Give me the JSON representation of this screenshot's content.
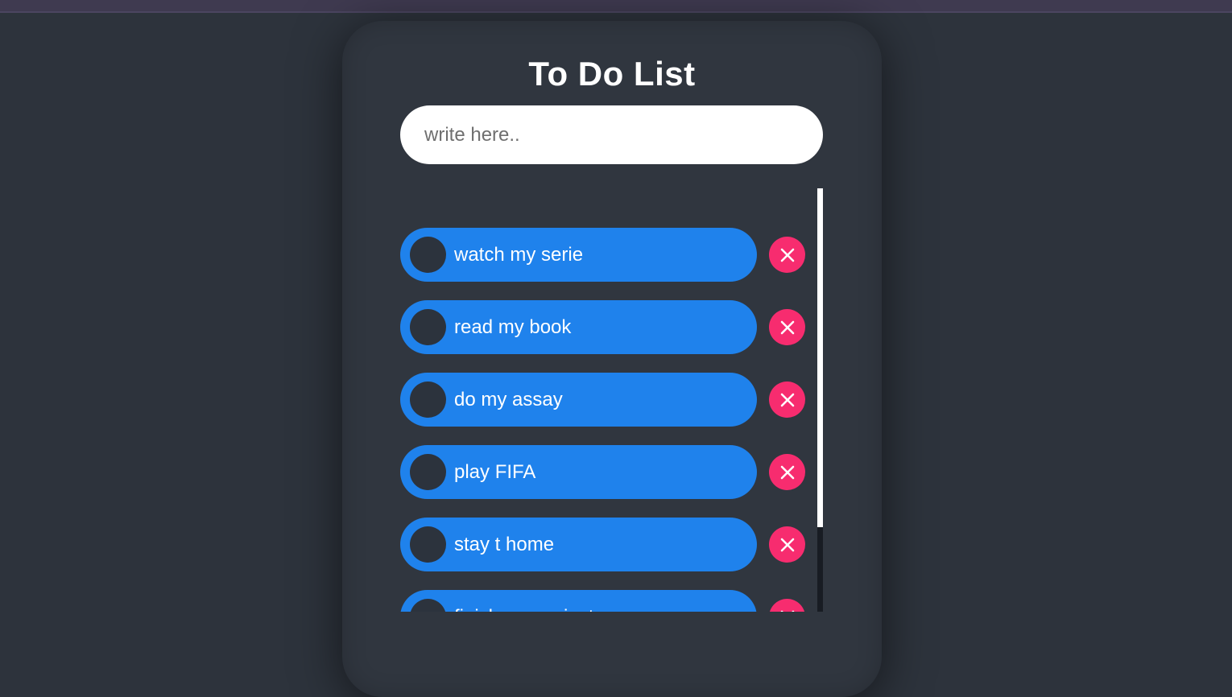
{
  "app": {
    "title": "To Do List"
  },
  "input": {
    "placeholder": "write here..",
    "value": ""
  },
  "todos": [
    {
      "label": "watch my serie",
      "done": false
    },
    {
      "label": "read my book",
      "done": false
    },
    {
      "label": "do my assay",
      "done": false
    },
    {
      "label": "play FIFA",
      "done": false
    },
    {
      "label": "stay t home",
      "done": false
    },
    {
      "label": "finish my project",
      "done": false
    }
  ],
  "icons": {
    "delete": "close-icon",
    "toggle": "circle-checkbox-icon"
  },
  "colors": {
    "page_background": "#2d333c",
    "card_background": "#30363f",
    "item_accent": "#1f82ec",
    "delete_accent": "#f72c6f",
    "checkbox_fill": "#2c333d",
    "text": "#ffffff"
  },
  "scroll": {
    "visible_fraction": 0.8,
    "position_fraction": 0
  }
}
